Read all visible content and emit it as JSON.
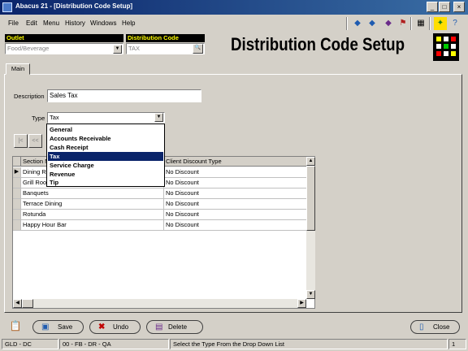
{
  "window": {
    "title": "Abacus 21 - [Distribution Code Setup]",
    "controls": [
      "_",
      "□",
      "×"
    ]
  },
  "menu": [
    "File",
    "Edit",
    "Menu",
    "History",
    "Windows",
    "Help"
  ],
  "header": {
    "outlet_label": "Outlet",
    "outlet_value": "Food/Beverage",
    "distribution_code_label": "Distribution Code",
    "distribution_code_value": "TAX",
    "heading": "Distribution Code Setup"
  },
  "tabs": [
    {
      "label": "Main"
    }
  ],
  "form": {
    "description_label": "Description",
    "description_value": "Sales Tax",
    "type_label": "Type",
    "type_value": "Tax",
    "type_options": [
      "General",
      "Accounts Receivable",
      "Cash Receipt",
      "Tax",
      "Service Charge",
      "Revenue",
      "Tip"
    ],
    "type_selected_index": 3,
    "nav_buttons": [
      "|<",
      "<<"
    ]
  },
  "grid": {
    "columns": [
      "Section N",
      "Client Discount Type"
    ],
    "rows": [
      [
        "Dining Ro",
        "No Discount"
      ],
      [
        "Grill Roo",
        "No Discount"
      ],
      [
        "Banquets",
        "No Discount"
      ],
      [
        "Terrace Dining",
        "No Discount"
      ],
      [
        "Rotunda",
        "No Discount"
      ],
      [
        "Happy Hour Bar",
        "No Discount"
      ]
    ]
  },
  "buttons": {
    "save": "Save",
    "undo": "Undo",
    "delete": "Delete",
    "close": "Close"
  },
  "status": {
    "company": "GLD - DC",
    "path": "00 - FB - DR - QA",
    "message": "Select the Type From the Drop Down List",
    "count": "1"
  },
  "colors": {
    "title_bar": "#0a246a",
    "label_bar_bg": "#000000",
    "label_bar_text": "#ffff00",
    "selection": "#0a246a",
    "window_bg": "#d4d0c8"
  }
}
